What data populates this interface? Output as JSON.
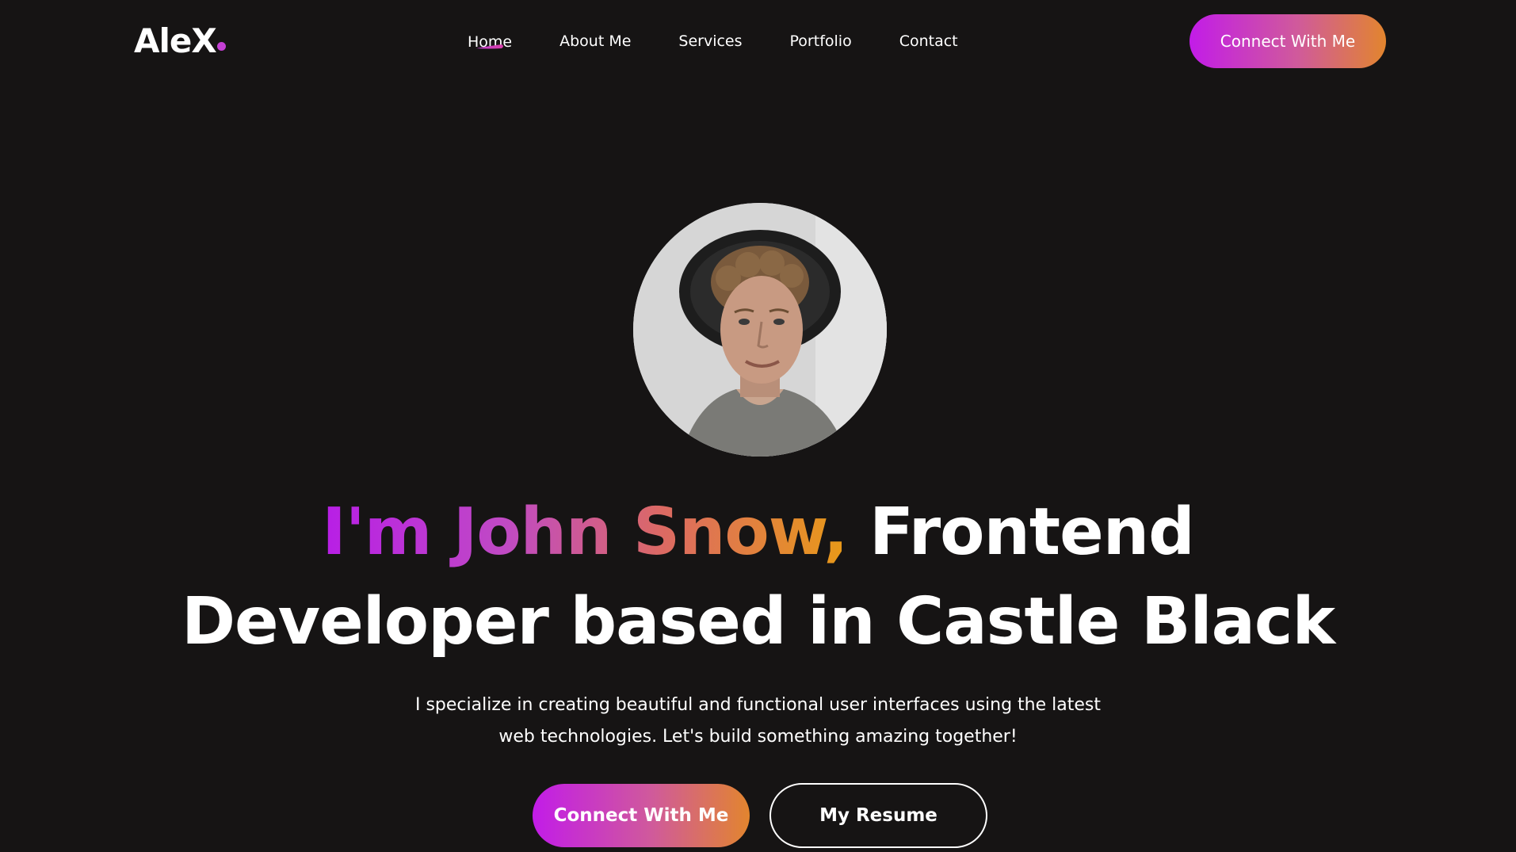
{
  "brand": {
    "logo_text": "AleX",
    "accent_color": "#c43fd4"
  },
  "nav": {
    "items": [
      {
        "label": "Home",
        "active": true
      },
      {
        "label": "About Me",
        "active": false
      },
      {
        "label": "Services",
        "active": false
      },
      {
        "label": "Portfolio",
        "active": false
      },
      {
        "label": "Contact",
        "active": false
      }
    ],
    "cta_label": "Connect With Me"
  },
  "hero": {
    "avatar_icon": "profile-photo",
    "title_highlight": "I'm John Snow,",
    "title_rest_line1": "Frontend",
    "title_line2": "Developer based in Castle Black",
    "description": "I specialize in creating beautiful and functional user interfaces using the latest web technologies. Let's build something amazing together!",
    "primary_button": "Connect With Me",
    "secondary_button": "My Resume"
  },
  "colors": {
    "background": "#161414",
    "gradient_start": "#c21ce8",
    "gradient_mid": "#d05a9b",
    "gradient_end": "#e2852e",
    "text": "#ffffff"
  }
}
